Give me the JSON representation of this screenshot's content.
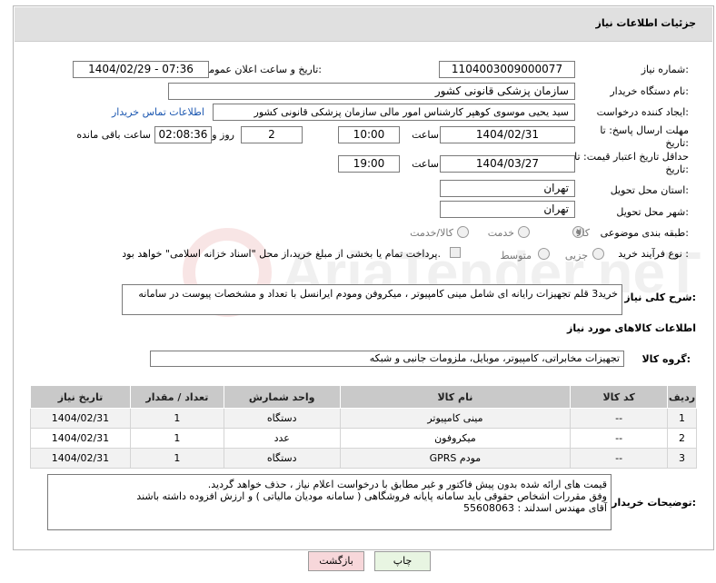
{
  "panel": {
    "title": "جزئیات اطلاعات نیاز"
  },
  "fields": {
    "need_number_label": "شماره نیاز:",
    "need_number": "1104003009000077",
    "announce_label": "تاریخ و ساعت اعلان عمومی:",
    "announce_value": "1404/02/29 - 07:36",
    "buyer_org_label": "نام دستگاه خریدار:",
    "buyer_org": "سازمان پزشکی قانونی کشور",
    "creator_label": "ایجاد کننده درخواست:",
    "creator": "سید یحیی موسوی کوهپر کارشناس امور مالی سازمان پزشکی قانونی کشور",
    "contact_link": "اطلاعات تماس خریدار",
    "reply_deadline_label": "مهلت ارسال پاسخ: تا تاریخ:",
    "reply_date": "1404/02/31",
    "time_label": "ساعت",
    "reply_time": "10:00",
    "days": "2",
    "days_label": "روز و",
    "remaining": "02:08:36",
    "remaining_label": "ساعت باقی مانده",
    "min_price_label": "حداقل تاریخ اعتبار قیمت: تا تاریخ:",
    "price_date": "1404/03/27",
    "price_time": "19:00",
    "province_label": "استان محل تحویل:",
    "province": "تهران",
    "city_label": "شهر محل تحویل:",
    "city": "تهران",
    "category_label": "طبقه بندی موضوعی:",
    "category_options": [
      "کالا",
      "خدمت",
      "کالا/خدمت"
    ],
    "process_label": "نوع فرآیند خرید :",
    "process_options": [
      "جزیی",
      "متوسط"
    ],
    "payment_note": "پرداخت تمام یا بخشی از مبلغ خرید،از محل \"اسناد خزانه اسلامی\" خواهد بود.",
    "desc_label": "شرح کلی نیاز:",
    "description": "خرید3 قلم تجهیزات رایانه ای شامل مینی کامپیوتر ، میکروفن ومودم ایرانسل با تعداد و مشخصات پیوست در سامانه",
    "goods_info_title": "اطلاعات کالاهای مورد نیاز",
    "goods_group_label": "گروه کالا:",
    "goods_group": "تجهیزات مخابراتی، کامپیوتر، موبایل، ملزومات جانبی و شبکه",
    "buyer_notes_label": "توضیحات خریدار:",
    "buyer_notes": [
      "قیمت های ارائه شده بدون پیش فاکتور  و غیر مطابق با درخواست اعلام نیاز  ، حذف خواهد گردید.",
      "وفق مقررات اشخاص حقوقی باید سامانه پایانه فروشگاهی ( سامانه مودیان مالیاتی ) و ارزش افزوده  داشته باشند",
      "آقای مهندس اسدلند :        55608063"
    ]
  },
  "table": {
    "headers": [
      "ردیف",
      "کد کالا",
      "نام کالا",
      "واحد شمارش",
      "تعداد / مقدار",
      "تاریخ نیاز"
    ],
    "rows": [
      [
        "1",
        "--",
        "مینی کامپیوتر",
        "دستگاه",
        "1",
        "1404/02/31"
      ],
      [
        "2",
        "--",
        "میکروفون",
        "عدد",
        "1",
        "1404/02/31"
      ],
      [
        "3",
        "--",
        "مودم GPRS",
        "دستگاه",
        "1",
        "1404/02/31"
      ]
    ]
  },
  "buttons": {
    "print": "چاپ",
    "back": "بازگشت"
  },
  "colors": {
    "header_bg": "#e0e0e0",
    "table_head": "#c9c9c9",
    "back_btn": "#f7d7da",
    "print_btn": "#e8f5e2"
  },
  "watermark_text": "AriaTender.neT"
}
